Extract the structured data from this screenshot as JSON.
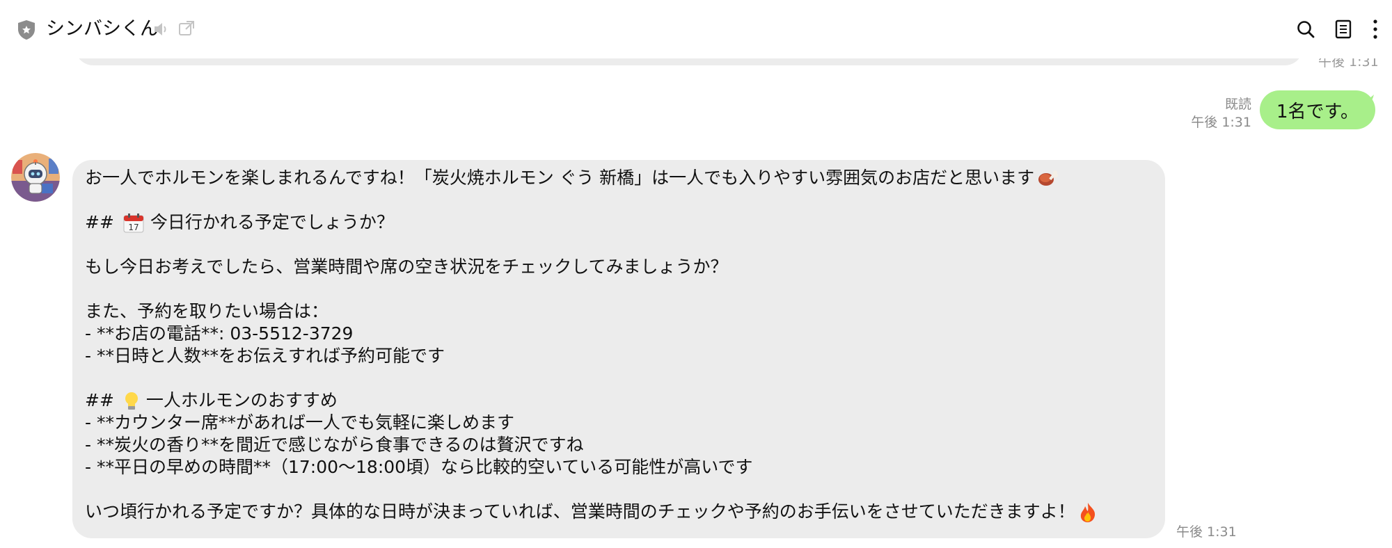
{
  "header": {
    "title": "シンバシくん",
    "icons": [
      "shield-icon",
      "mute-icon",
      "external-window-icon",
      "search-icon",
      "notes-icon",
      "more-icon"
    ]
  },
  "previous": {
    "time": "午後 1:31"
  },
  "sent": {
    "read_label": "既読",
    "time": "午後 1:31",
    "text": "1名です。"
  },
  "received": {
    "time": "午後 1:31",
    "lines": {
      "l1": "お一人でホルモンを楽しまれるんですね！「炭火焼ホルモン ぐう 新橋」は一人でも入りやすい雰囲気のお店だと思います",
      "l2_prefix": "##",
      "l2_text": "今日行かれる予定でしょうか？",
      "l3": "もし今日お考えでしたら、営業時間や席の空き状況をチェックしてみましょうか？",
      "l4": "また、予約を取りたい場合は：",
      "l5": "- **お店の電話**: 03-5512-3729",
      "l6": "- **日時と人数**をお伝えすれば予約可能です",
      "l7_prefix": "##",
      "l7_text": "一人ホルモンのおすすめ",
      "l8": "- **カウンター席**があれば一人でも気軽に楽しめます",
      "l9": "- **炭火の香り**を間近で感じながら食事できるのは贅沢ですね",
      "l10": "- **平日の早めの時間**（17:00〜18:00頃）なら比較的空いている可能性が高いです",
      "l11": "いつ頃行かれる予定ですか？具体的な日時が決まっていれば、営業時間のチェックや予約のお手伝いをさせていただきますよ！"
    },
    "emojis": [
      "meat-on-bone-icon",
      "calendar-icon",
      "light-bulb-icon",
      "fire-icon"
    ]
  },
  "colors": {
    "sent_bubble": "#a8ef8a",
    "received_bubble": "#ececec",
    "meta_text": "#8a8a8a"
  }
}
